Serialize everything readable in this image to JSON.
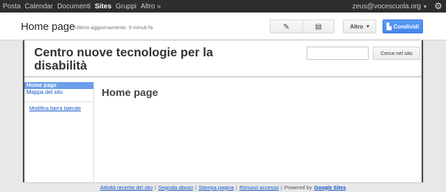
{
  "gbar": {
    "nav": [
      "Posta",
      "Calendar",
      "Documenti",
      "Sites",
      "Gruppi",
      "Altro »"
    ],
    "active": "Sites",
    "user": "zeus@vocescuola.org",
    "user_caret": "▾",
    "gear_icon": "⚙"
  },
  "header": {
    "title": "Home page",
    "updated": "Ultimo aggiornamento: 9 minuti fa",
    "edit_icon": "✎",
    "new_page_icon": "▤",
    "more_label": "Altro",
    "more_caret": "▾",
    "share_icon": "▙",
    "share_label": "Condividi",
    "accent_color": "#4485ee"
  },
  "site": {
    "title": "Centro nuove tecnologie per la disabilità",
    "search_placeholder": "",
    "search_button": "Cerca nel sito",
    "sidebar": {
      "items": [
        "Home page",
        "Mappa del sito"
      ],
      "active_index": 0,
      "edit_link": "Modifica barra laterale"
    },
    "page_heading": "Home page"
  },
  "footer": {
    "links": [
      "Attività recente del sito",
      "Segnala abuso",
      "Stampa pagina",
      "Rimuovi accesso"
    ],
    "powered_by": "Powered by",
    "google_sites": "Google Sites"
  }
}
